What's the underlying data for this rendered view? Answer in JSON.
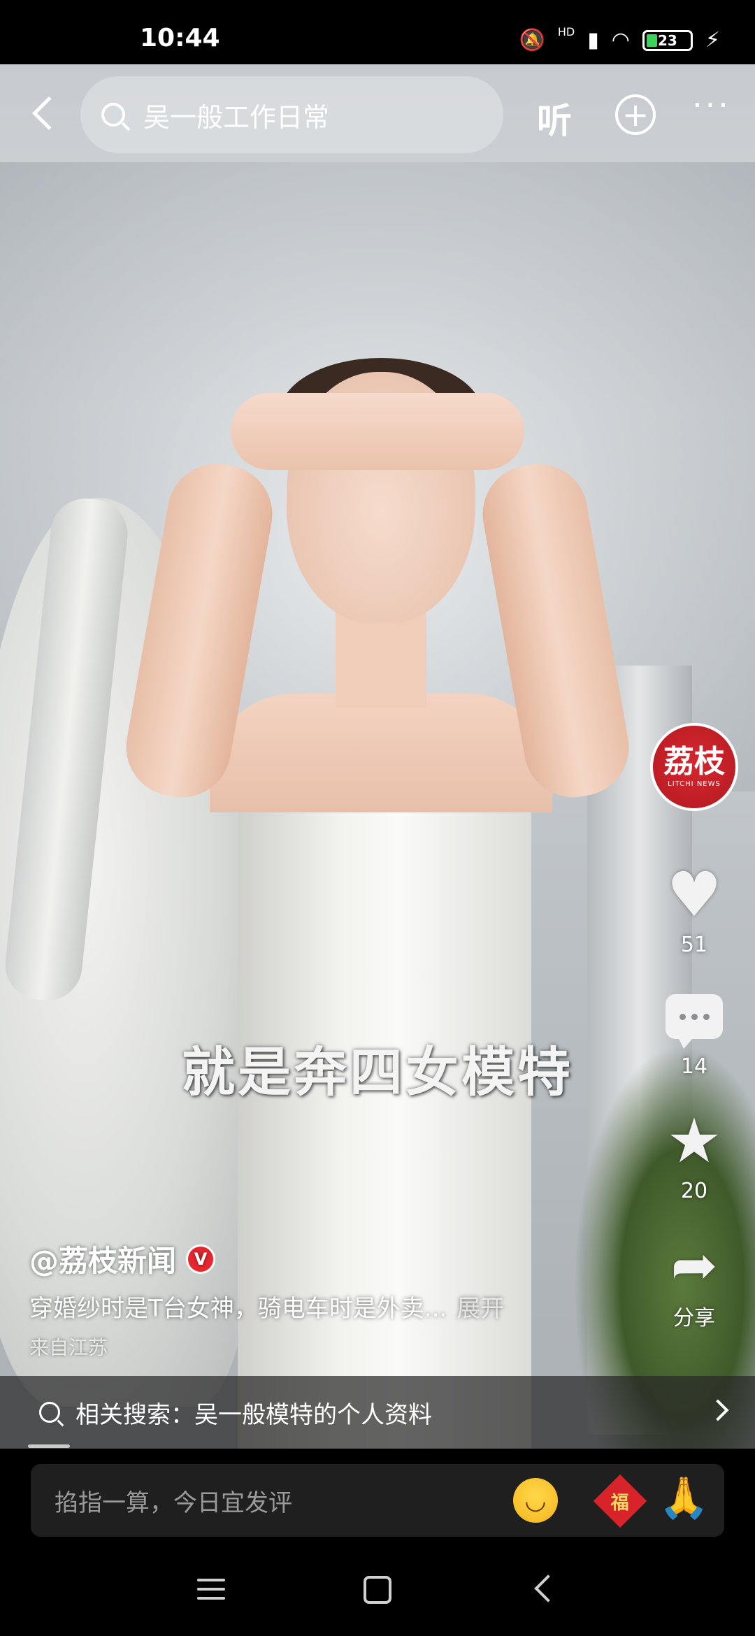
{
  "status_bar": {
    "time": "10:44",
    "network_label": "HD",
    "battery": "23"
  },
  "top_bar": {
    "search_query": "吴一般工作日常",
    "listen_label": "听",
    "add_label": "+",
    "more_label": "···"
  },
  "video": {
    "subtitle": "就是奔四女模特"
  },
  "right_rail": {
    "avatar_text": "荔枝",
    "avatar_subtext": "LITCHI NEWS",
    "like_count": "51",
    "comment_count": "14",
    "favorite_count": "20",
    "share_label": "分享"
  },
  "post": {
    "author": "@荔枝新闻",
    "verified_label": "V",
    "description": "穿婚纱时是T台女神，骑电车时是外卖...",
    "expand_label": "展开",
    "location": "来自江苏"
  },
  "related_search": {
    "text": "相关搜索：吴一般模特的个人资料"
  },
  "comment_bar": {
    "placeholder": "掐指一算，今日宜发评",
    "fu_label": "福"
  },
  "icons": {
    "back": "back-chevron-icon",
    "search": "search-icon",
    "like": "heart-icon",
    "comment": "comment-bubble-icon",
    "favorite": "star-icon",
    "share": "share-arrow-icon"
  },
  "colors": {
    "verified": "#e8262e",
    "avatar_bg": "#c8202a",
    "comment_bar_bg": "#1f1f1f"
  }
}
